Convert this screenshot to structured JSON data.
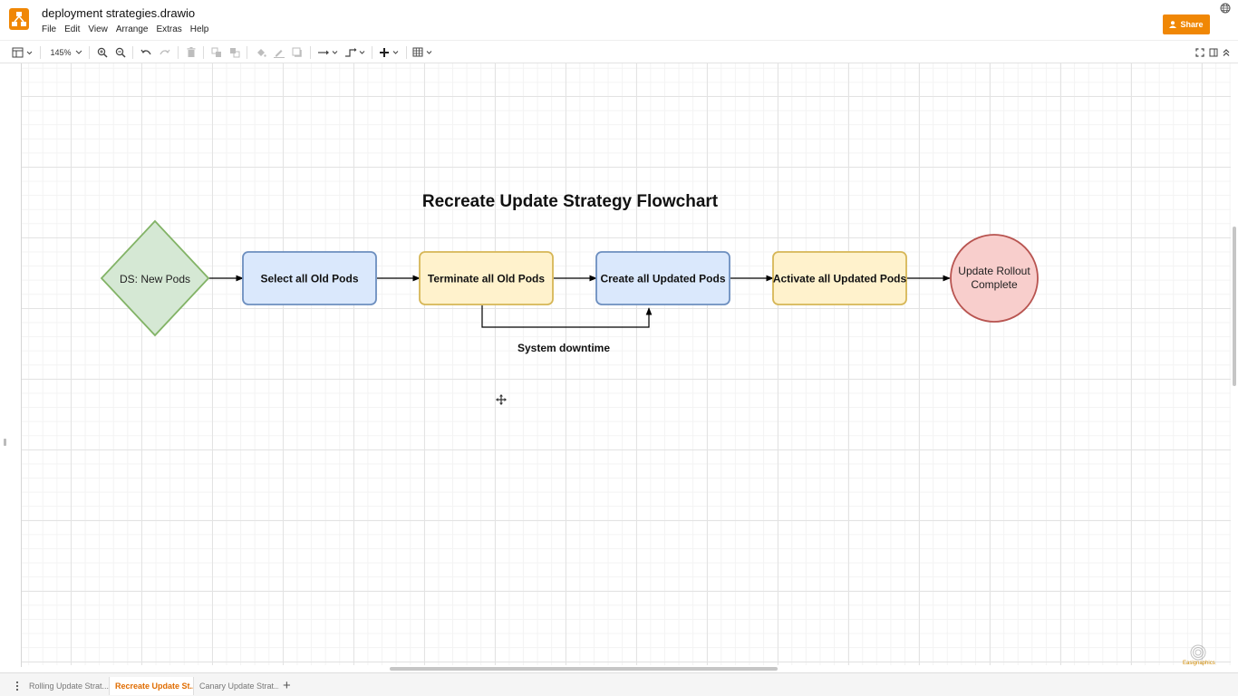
{
  "app": {
    "document_title": "deployment strategies.drawio",
    "menu": [
      "File",
      "Edit",
      "View",
      "Arrange",
      "Extras",
      "Help"
    ],
    "share_label": "Share",
    "brand_color": "#f08705"
  },
  "toolbar": {
    "zoom": "145%"
  },
  "diagram": {
    "title": "Recreate Update Strategy Flowchart",
    "decision_label": "DS: New Pods",
    "steps": [
      {
        "label": "Select all Old Pods",
        "fill": "#dae8fc",
        "stroke": "#6c8ebf"
      },
      {
        "label": "Terminate all Old Pods",
        "fill": "#fff2cc",
        "stroke": "#d6b656"
      },
      {
        "label": "Create all Updated Pods",
        "fill": "#dae8fc",
        "stroke": "#6c8ebf"
      },
      {
        "label": "Activate all Updated Pods",
        "fill": "#fff2cc",
        "stroke": "#d6b656"
      }
    ],
    "end_label_line1": "Update Rollout",
    "end_label_line2": "Complete",
    "annotation": "System downtime",
    "decision_fill": "#d5e8d4",
    "decision_stroke": "#82b366",
    "end_fill": "#f8cecc",
    "end_stroke": "#b85450"
  },
  "pages": [
    {
      "label": "Rolling Update Strat...",
      "active": false
    },
    {
      "label": "Recreate Update St...",
      "active": true
    },
    {
      "label": "Canary Update Strat...",
      "active": false
    }
  ],
  "watermark_text": "Easignaphics"
}
